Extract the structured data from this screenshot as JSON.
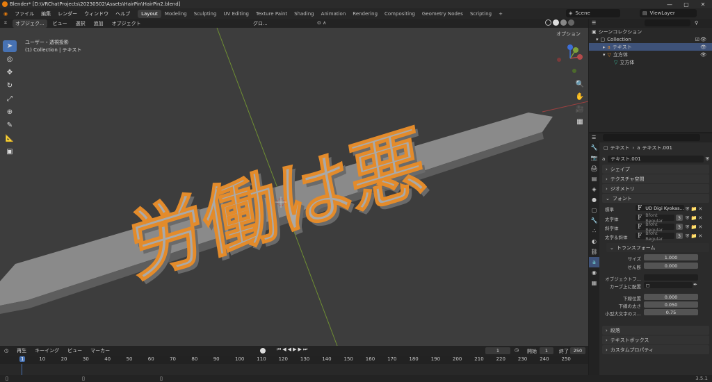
{
  "window": {
    "title": "Blender* [D:\\VRChatProjects\\20230502\\Assets\\HairPin\\HairPin2.blend]"
  },
  "menu": [
    "ファイル",
    "編集",
    "レンダー",
    "ウィンドウ",
    "ヘルプ"
  ],
  "workspaces": [
    "Layout",
    "Modeling",
    "Sculpting",
    "UV Editing",
    "Texture Paint",
    "Shading",
    "Animation",
    "Rendering",
    "Compositing",
    "Geometry Nodes",
    "Scripting"
  ],
  "active_workspace": "Layout",
  "scene": "Scene",
  "view_layer": "ViewLayer",
  "viewport_header": {
    "mode": "オブジェク...",
    "menus": [
      "ビュー",
      "選択",
      "追加",
      "オブジェクト"
    ],
    "transform": "グロ...",
    "options": "オプション"
  },
  "viewport": {
    "view_name": "ユーザー・透視投影",
    "collection_info": "(1) Collection | テキスト",
    "text_object": "労働は悪"
  },
  "outliner": {
    "rows": [
      {
        "label": "シーンコレクション"
      },
      {
        "label": "Collection"
      },
      {
        "label": "テキスト"
      },
      {
        "label": "立方体"
      },
      {
        "label": "立方体"
      }
    ]
  },
  "properties": {
    "object_name": "テキスト",
    "data_name": "テキスト.001",
    "data_field": "テキスト.001",
    "panels_top": [
      "シェイプ",
      "テクスチャ空間",
      "ジオメトリ",
      "フォント"
    ],
    "fonts": [
      {
        "label": "標準",
        "value": "UD Digi Kyokas..."
      },
      {
        "label": "太字体",
        "value": "Bfont Regular",
        "users": "3"
      },
      {
        "label": "斜字体",
        "value": "Bfont Regular",
        "users": "3"
      },
      {
        "label": "太字＆斜体",
        "value": "Bfont Regular",
        "users": "3"
      }
    ],
    "transform_panel": "トランスフォーム",
    "size_label": "サイズ",
    "size": "1.000",
    "shear_label": "せん断",
    "shear": "0.000",
    "object_font_label": "オブジェクトフ...",
    "curve_label": "カーブ上に配置",
    "underline_pos_label": "下線位置",
    "underline_pos": "0.000",
    "underline_thick_label": "下線の太さ",
    "underline_thick": "0.050",
    "smallcaps_label": "小型大文字のス...",
    "smallcaps": "0.75",
    "panels_bottom": [
      "段落",
      "テキストボックス",
      "カスタムプロパティ"
    ]
  },
  "timeline": {
    "menus": [
      "再生",
      "キーイング",
      "ビュー",
      "マーカー"
    ],
    "current_frame": "1",
    "start_label": "開始",
    "start": "1",
    "end_label": "終了",
    "end": "250",
    "ticks": [
      "1",
      "10",
      "20",
      "30",
      "40",
      "50",
      "60",
      "70",
      "80",
      "90",
      "100",
      "110",
      "120",
      "130",
      "140",
      "150",
      "160",
      "170",
      "180",
      "190",
      "200",
      "210",
      "220",
      "230",
      "240",
      "250"
    ]
  },
  "version": "3.5.1",
  "colors": {
    "accent": "#4772b3",
    "selection_outline": "#e38b2b",
    "x_axis": "#b44b4b",
    "y_axis": "#7ea23a"
  }
}
